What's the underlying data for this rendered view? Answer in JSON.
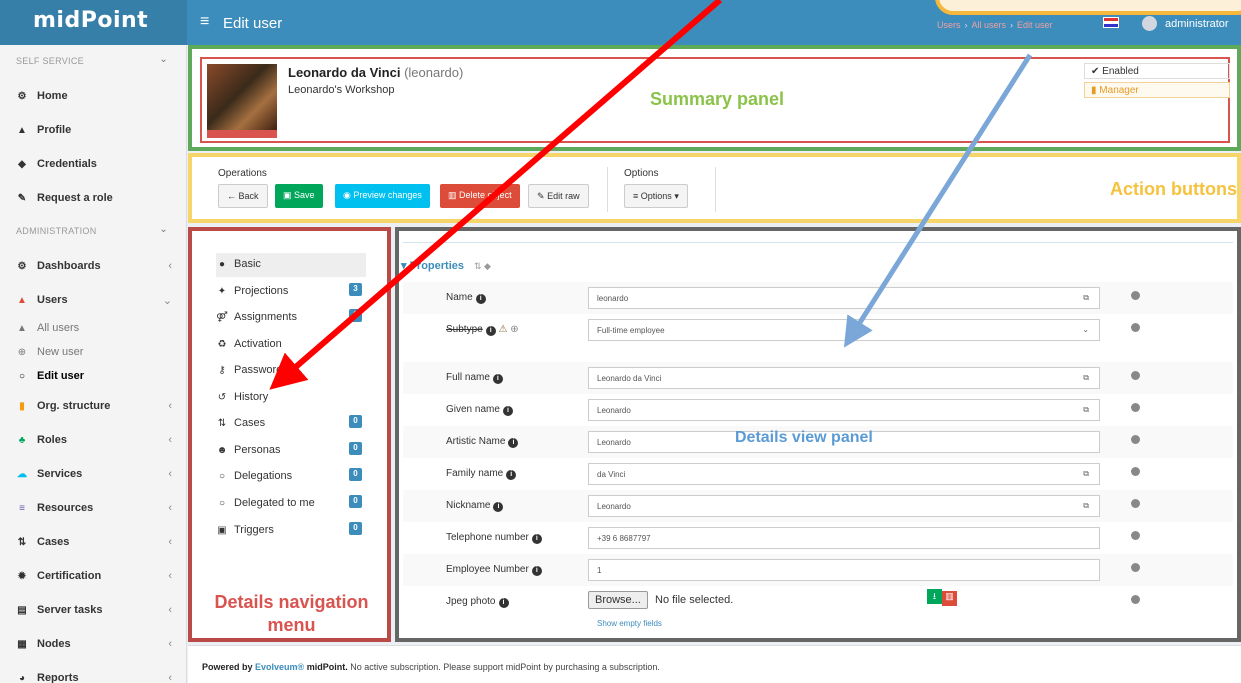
{
  "header": {
    "brand": "midPoint",
    "hamburger_icon": "bars-icon",
    "page_title": "Edit user",
    "breadcrumb": [
      "Users",
      "All users",
      "Edit user"
    ],
    "user_name": "administrator"
  },
  "sidebar": {
    "self_service_header": "SELF SERVICE",
    "self_service": [
      {
        "label": "Home",
        "icon": "dashboard-icon",
        "glyph": "⚙"
      },
      {
        "label": "Profile",
        "icon": "user-icon",
        "glyph": "▲"
      },
      {
        "label": "Credentials",
        "icon": "shield-icon",
        "glyph": "◆"
      },
      {
        "label": "Request a role",
        "icon": "edit-icon",
        "glyph": "✎"
      }
    ],
    "administration_header": "ADMINISTRATION",
    "administration": [
      {
        "label": "Dashboards",
        "icon": "dashboard-icon",
        "glyph": "⚙"
      },
      {
        "label": "Users",
        "icon": "user-icon",
        "glyph": "▲"
      },
      {
        "label": "Org. structure",
        "icon": "building-icon",
        "glyph": "▮"
      },
      {
        "label": "Roles",
        "icon": "roles-icon",
        "glyph": "♣"
      },
      {
        "label": "Services",
        "icon": "cloud-icon",
        "glyph": "☁"
      },
      {
        "label": "Resources",
        "icon": "database-icon",
        "glyph": "≡"
      },
      {
        "label": "Cases",
        "icon": "cases-icon",
        "glyph": "⇅"
      },
      {
        "label": "Certification",
        "icon": "certificate-icon",
        "glyph": "✹"
      },
      {
        "label": "Server tasks",
        "icon": "tasks-icon",
        "glyph": "▤"
      },
      {
        "label": "Nodes",
        "icon": "nodes-icon",
        "glyph": "▦"
      },
      {
        "label": "Reports",
        "icon": "reports-icon",
        "glyph": "◕"
      }
    ],
    "users_sub": [
      {
        "label": "All users",
        "icon": "user-small-icon",
        "glyph": "▲"
      },
      {
        "label": "New user",
        "icon": "plus-circle-icon",
        "glyph": "⊕"
      },
      {
        "label": "Edit user",
        "icon": "circle-o-icon",
        "glyph": "○"
      }
    ]
  },
  "summary": {
    "name": "Leonardo da Vinci",
    "username": "(leonardo)",
    "organization": "Leonardo's Workshop",
    "annotation": "Summary panel",
    "status_enabled": "Enabled",
    "status_manager": "Manager"
  },
  "actions": {
    "operations_label": "Operations",
    "options_label": "Options",
    "back": "Back",
    "save": "Save",
    "preview": "Preview changes",
    "delete": "Delete object",
    "edit_raw": "Edit raw",
    "options_btn": "Options",
    "annotation": "Action buttons"
  },
  "nav": {
    "items": [
      {
        "label": "Basic",
        "icon": "circle-icon",
        "glyph": "●",
        "badge": ""
      },
      {
        "label": "Projections",
        "icon": "projections-icon",
        "glyph": "✦",
        "badge": "3"
      },
      {
        "label": "Assignments",
        "icon": "assignments-icon",
        "glyph": "⚤",
        "badge": "6"
      },
      {
        "label": "Activation",
        "icon": "recycle-icon",
        "glyph": "♻",
        "badge": ""
      },
      {
        "label": "Password",
        "icon": "key-icon",
        "glyph": "⚷",
        "badge": ""
      },
      {
        "label": "History",
        "icon": "history-icon",
        "glyph": "↺",
        "badge": ""
      },
      {
        "label": "Cases",
        "icon": "cases-icon",
        "glyph": "⇅",
        "badge": "0"
      },
      {
        "label": "Personas",
        "icon": "users-icon",
        "glyph": "☻",
        "badge": "0"
      },
      {
        "label": "Delegations",
        "icon": "circle-o-icon",
        "glyph": "○",
        "badge": "0"
      },
      {
        "label": "Delegated to me",
        "icon": "circle-o-icon",
        "glyph": "○",
        "badge": "0"
      },
      {
        "label": "Triggers",
        "icon": "calendar-check-icon",
        "glyph": "▣",
        "badge": "0"
      }
    ],
    "annotation_line1": "Details navigation",
    "annotation_line2": "menu"
  },
  "details": {
    "section_title": "Properties",
    "annotation": "Details view panel",
    "fields": [
      {
        "label": "Name",
        "value": "leonardo"
      },
      {
        "label": "Subtype",
        "value": "Full-time employee"
      },
      {
        "label": "Full name",
        "value": "Leonardo da Vinci"
      },
      {
        "label": "Given name",
        "value": "Leonardo"
      },
      {
        "label": "Artistic Name",
        "value": "Leonardo"
      },
      {
        "label": "Family name",
        "value": "da Vinci"
      },
      {
        "label": "Nickname",
        "value": "Leonardo"
      },
      {
        "label": "Telephone number",
        "value": "+39 6 8687797"
      },
      {
        "label": "Employee Number",
        "value": "1"
      },
      {
        "label": "Jpeg photo",
        "value": ""
      }
    ],
    "browse_label": "Browse...",
    "file_status": "No file selected.",
    "show_empty": "Show empty fields"
  },
  "footer": {
    "powered_by": "Powered by",
    "vendor": "Evolveum®",
    "product": "midPoint.",
    "notice": "No active subscription. Please support midPoint by purchasing a subscription."
  },
  "colors": {
    "header_blue": "#3c8dbc",
    "summary_border": "#5eaa5a",
    "action_border": "#f6d66a",
    "nav_border": "#b94a48",
    "details_border": "#666666",
    "arrow_red": "#ff0000",
    "arrow_blue": "#7aa7d8"
  }
}
